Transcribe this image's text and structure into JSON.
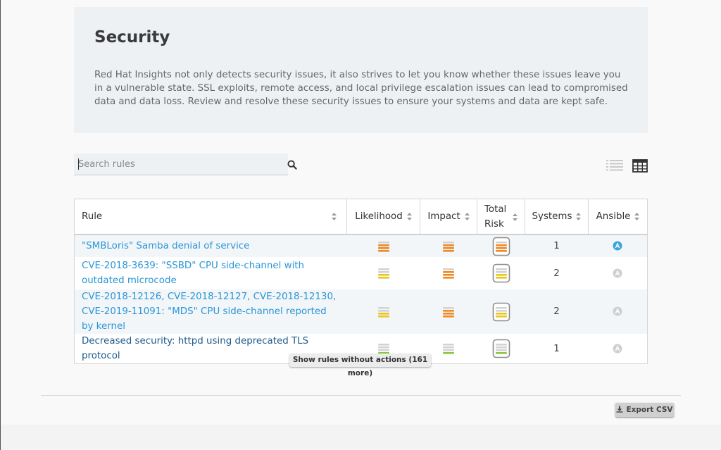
{
  "header": {
    "title": "Security",
    "description": "Red Hat Insights not only detects security issues, it also strives to let you know whether these issues leave you in a vulnerable state. SSL exploits, remote access, and local privilege escalation issues can lead to compromised data and data loss. Review and resolve these security issues to ensure your systems and data are kept safe."
  },
  "search": {
    "placeholder": "Search rules",
    "value": "",
    "icon": "search-icon"
  },
  "view_toggle": {
    "list_icon": "list-view-icon",
    "table_icon": "table-view-icon",
    "active": "table"
  },
  "table": {
    "columns": {
      "rule": "Rule",
      "likelihood": "Likelihood",
      "impact": "Impact",
      "total_risk_line1": "Total",
      "total_risk_line2": "Risk",
      "systems": "Systems",
      "ansible": "Ansible"
    },
    "rows": [
      {
        "rule": "\"SMBLoris\" Samba denial of service",
        "likelihood": {
          "level": 3,
          "color": "#f08a24"
        },
        "impact": {
          "level": 3,
          "color": "#f08a24"
        },
        "total_risk": {
          "level": 3,
          "color": "#f08a24"
        },
        "systems": "1",
        "ansible": "supported"
      },
      {
        "rule": "CVE-2018-3639: \"SSBD\" CPU side-channel with outdated microcode",
        "likelihood": {
          "level": 2,
          "color": "#e6c81e"
        },
        "impact": {
          "level": 3,
          "color": "#f08a24"
        },
        "total_risk": {
          "level": 2,
          "color": "#e6c81e"
        },
        "systems": "2",
        "ansible": "unsupported"
      },
      {
        "rule": "CVE-2018-12126, CVE-2018-12127, CVE-2018-12130, CVE-2019-11091: \"MDS\" CPU side-channel reported by kernel",
        "likelihood": {
          "level": 2,
          "color": "#e6c81e"
        },
        "impact": {
          "level": 3,
          "color": "#f08a24"
        },
        "total_risk": {
          "level": 2,
          "color": "#e6c81e"
        },
        "systems": "2",
        "ansible": "unsupported"
      },
      {
        "rule": "Decreased security: httpd using deprecated TLS protocol",
        "likelihood": {
          "level": 1,
          "color": "#8cc63f"
        },
        "impact": {
          "level": 1,
          "color": "#8cc63f"
        },
        "total_risk": {
          "level": 1,
          "color": "#8cc63f"
        },
        "systems": "1",
        "ansible": "unsupported"
      }
    ]
  },
  "show_more_label": "Show rules without actions (161 more)",
  "export": {
    "label": "Export CSV",
    "icon": "download-icon"
  },
  "colors": {
    "link": "#2a96d6",
    "critical_orange": "#f08a24",
    "moderate_yellow": "#e6c81e",
    "low_green": "#8cc63f",
    "ansible_blue": "#39a5dc"
  }
}
